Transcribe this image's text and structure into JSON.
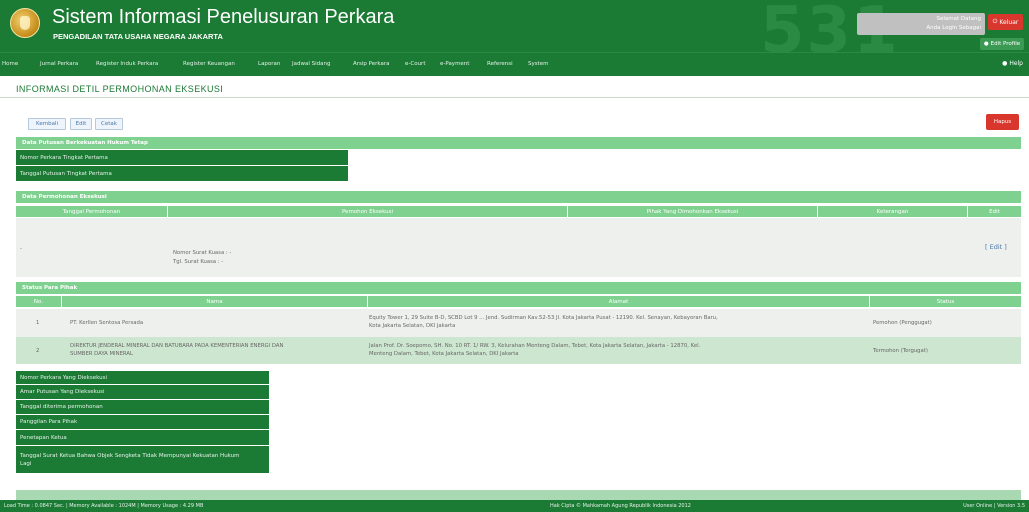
{
  "header": {
    "title": "Sistem Informasi Penelusuran Perkara",
    "subtitle": "PENGADILAN TATA USAHA NEGARA JAKARTA",
    "bg_number": "531",
    "welcome_line1": "Selamat Datang",
    "welcome_line2": "Anda Login Sebagai",
    "logout_label": "Keluar",
    "profile_label": "Edit Profile"
  },
  "nav": {
    "items": [
      "Home",
      "Jurnal Perkara",
      "Register Induk Perkara",
      "Register Keuangan",
      "Laporan",
      "Jadwal Sidang",
      "Arsip Perkara",
      "e-Court",
      "e-Payment",
      "Referensi",
      "System"
    ],
    "help": "Help"
  },
  "page": {
    "title": "INFORMASI DETIL PERMOHONAN EKSEKUSI",
    "buttons": {
      "back": "Kembali",
      "edit": "Edit",
      "print": "Cetak",
      "delete": "Hapus"
    }
  },
  "section_putusan": {
    "title": "Data Putusan Berkekuatan Hukum Tetap",
    "labels": [
      "Nomor Perkara Tingkat Pertama",
      "Tanggal Putusan Tingkat Pertama"
    ]
  },
  "section_permohonan": {
    "title": "Data Permohonan Eksekusi",
    "columns": [
      "Tanggal Permohonan",
      "Pemohon Eksekusi",
      "Pihak Yang Dimohonkan Eksekusi",
      "Keterangan",
      "Edit"
    ],
    "row": {
      "marker": "-",
      "nomor_surat": "Nomor Surat Kuasa : -",
      "tgl_surat": "Tgl. Surat Kuasa : -",
      "edit": "[ Edit ]"
    }
  },
  "section_pihak": {
    "title": "Status Para Pihak",
    "columns": [
      "No.",
      "Nama",
      "Alamat",
      "Status"
    ],
    "rows": [
      {
        "no": "1",
        "nama": "PT. Kerllen Sentosa Persada",
        "alamat_1": "Equity Tower 1, 29 Suite B-D, SCBD Lot 9 ... Jend. Sudirman Kav.52-53 Jl. Kota Jakarta Pusat - 12190. Kel. Senayan, Kebayoran Baru,",
        "alamat_2": "Kota Jakarta Selatan, DKI Jakarta",
        "status": "Pemohon (Penggugat)"
      },
      {
        "no": "2",
        "nama_1": "DIREKTUR JENDERAL MINERAL DAN BATUBARA PADA KEMENTERIAN ENERGI DAN",
        "nama_2": "SUMBER DAYA MINERAL",
        "alamat_1": "Jalan Prof. Dr. Soepomo, SH. No. 10 RT. 1/ RW. 3, Kelurahan Menteng Dalam, Tebet, Kota Jakarta Selatan, Jakarta - 12870, Kel.",
        "alamat_2": "Menteng Dalam, Tebet, Kota Jakarta Selatan, DKI Jakarta",
        "status": "Termohon (Tergugat)"
      }
    ]
  },
  "section_eksekusi": {
    "labels": [
      "Nomor Perkara Yang Dieksekusi",
      "Amar Putusan Yang Dieksekusi",
      "Tanggal diterima permohonan",
      "Panggilan Para Pihak",
      "Penetapan Ketua",
      "Tanggal Surat Ketua Bahwa Objek Sengketa Tidak Mempunyai Kekuatan Hukum Lagi"
    ]
  },
  "footer": {
    "left": "Load Time : 0.0847 Sec. | Memory Available : 1024M | Memory Usage : 4.29 MB",
    "center": "Hak Cipta © Mahkamah Agung Republik Indonesia 2012",
    "right": "User Online | Version 3.5"
  }
}
